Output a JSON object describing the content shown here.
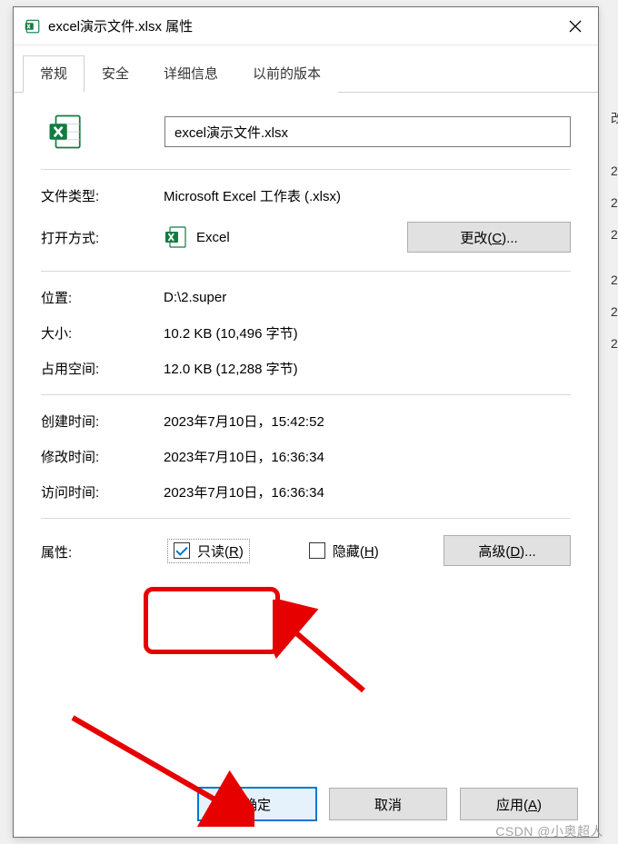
{
  "window": {
    "title": "excel演示文件.xlsx 属性"
  },
  "tabs": {
    "general": "常规",
    "security": "安全",
    "details": "详细信息",
    "previous": "以前的版本"
  },
  "filename": "excel演示文件.xlsx",
  "labels": {
    "filetype": "文件类型:",
    "openwith": "打开方式:",
    "location": "位置:",
    "size": "大小:",
    "diskspace": "占用空间:",
    "created": "创建时间:",
    "modified": "修改时间:",
    "accessed": "访问时间:",
    "attributes": "属性:"
  },
  "values": {
    "filetype": "Microsoft Excel 工作表 (.xlsx)",
    "openwith_app": "Excel",
    "location": "D:\\2.super",
    "size": "10.2 KB (10,496 字节)",
    "diskspace": "12.0 KB (12,288 字节)",
    "created": "2023年7月10日，15:42:52",
    "modified": "2023年7月10日，16:36:34",
    "accessed": "2023年7月10日，16:36:34"
  },
  "buttons": {
    "change": "更改(C)...",
    "advanced": "高级(D)...",
    "ok": "确定",
    "cancel": "取消",
    "apply": "应用(A)"
  },
  "checkboxes": {
    "readonly": "只读(R)",
    "hidden": "隐藏(H)"
  },
  "watermark": "CSDN @小奥超人"
}
